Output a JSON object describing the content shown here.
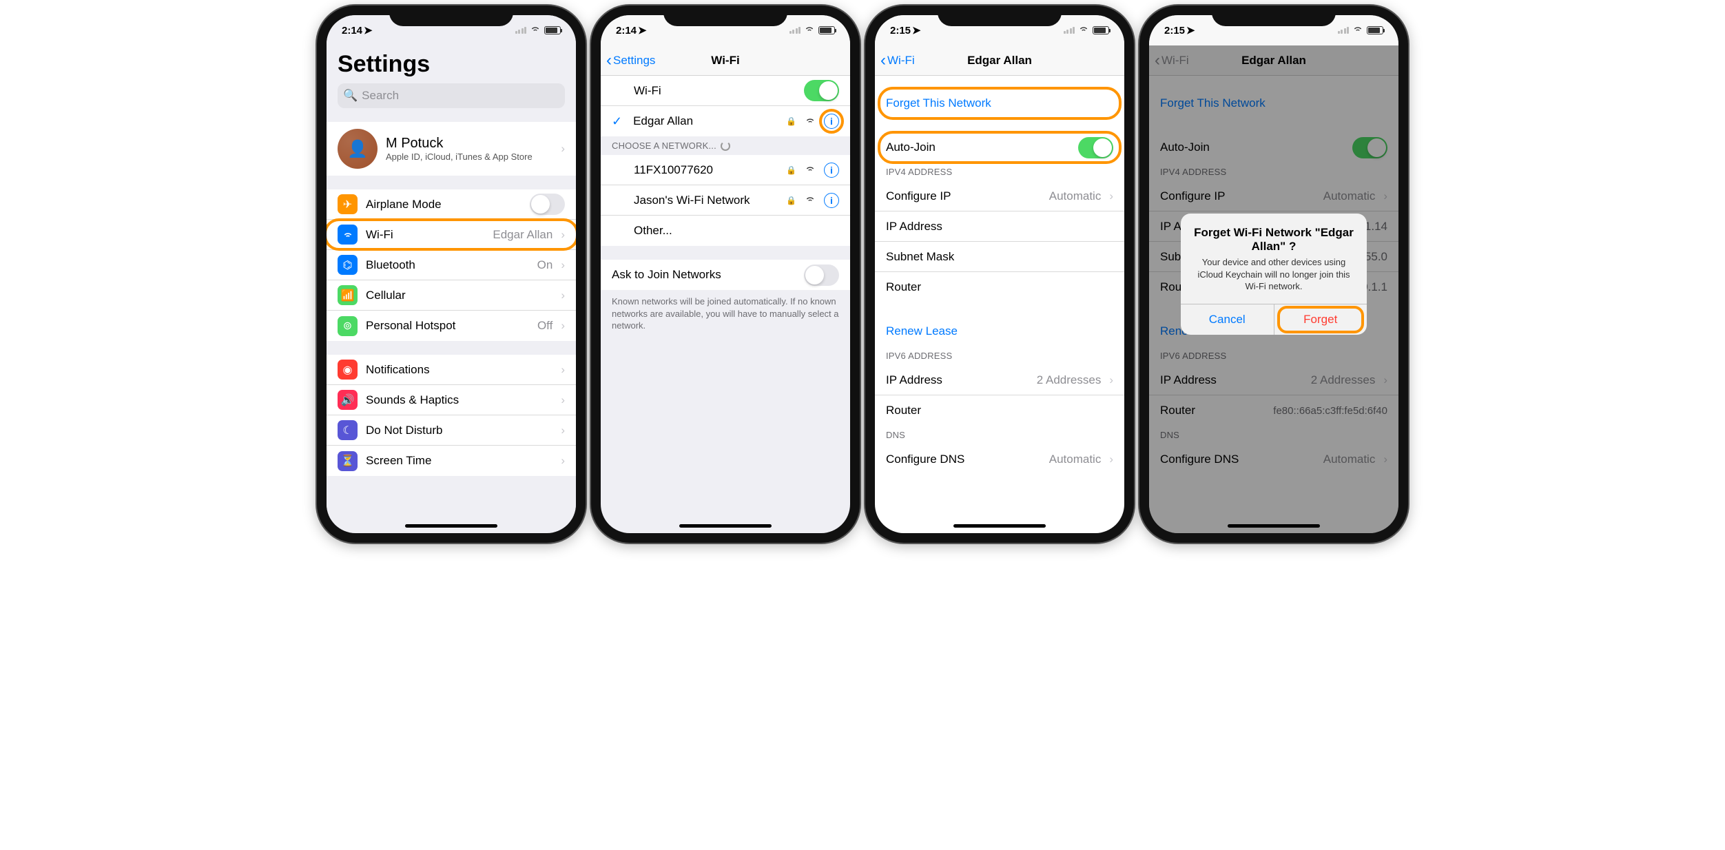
{
  "s1": {
    "time": "2:14",
    "title": "Settings",
    "search_placeholder": "Search",
    "profile": {
      "name": "M Potuck",
      "sub": "Apple ID, iCloud, iTunes & App Store"
    },
    "rows": {
      "airplane": "Airplane Mode",
      "wifi": "Wi-Fi",
      "wifi_val": "Edgar Allan",
      "bluetooth": "Bluetooth",
      "bluetooth_val": "On",
      "cellular": "Cellular",
      "hotspot": "Personal Hotspot",
      "hotspot_val": "Off",
      "notifications": "Notifications",
      "sounds": "Sounds & Haptics",
      "dnd": "Do Not Disturb",
      "screentime": "Screen Time"
    }
  },
  "s2": {
    "time": "2:14",
    "back": "Settings",
    "title": "Wi-Fi",
    "wifi_label": "Wi-Fi",
    "connected": "Edgar Allan",
    "choose_header": "CHOOSE A NETWORK...",
    "networks": {
      "n1": "11FX10077620",
      "n2": "Jason's Wi-Fi Network",
      "other": "Other..."
    },
    "ask_label": "Ask to Join Networks",
    "ask_footer": "Known networks will be joined automatically. If no known networks are available, you will have to manually select a network."
  },
  "s3": {
    "time": "2:15",
    "back": "Wi-Fi",
    "title": "Edgar Allan",
    "forget": "Forget This Network",
    "autojoin": "Auto-Join",
    "ipv4_header": "IPV4 ADDRESS",
    "configure_ip": "Configure IP",
    "configure_ip_val": "Automatic",
    "ip_addr": "IP Address",
    "subnet": "Subnet Mask",
    "router": "Router",
    "renew": "Renew Lease",
    "ipv6_header": "IPV6 ADDRESS",
    "ipv6_ip": "IP Address",
    "ipv6_ip_val": "2 Addresses",
    "ipv6_router": "Router",
    "dns_header": "DNS",
    "configure_dns": "Configure DNS",
    "configure_dns_val": "Automatic"
  },
  "s4": {
    "time": "2:15",
    "back": "Wi-Fi",
    "title": "Edgar Allan",
    "forget": "Forget This Network",
    "autojoin": "Auto-Join",
    "ipv4_header": "IPV4 ADDRESS",
    "configure_ip": "Configure IP",
    "configure_ip_val": "Automatic",
    "ip_addr": "IP Address",
    "ip_addr_val": "10.0.1.14",
    "subnet": "Subnet Mask",
    "subnet_val": "255.255.255.0",
    "router": "Router",
    "router_val": "10.0.1.1",
    "renew": "Renew Lease",
    "ipv6_header": "IPV6 ADDRESS",
    "ipv6_ip": "IP Address",
    "ipv6_ip_val": "2 Addresses",
    "ipv6_router": "Router",
    "ipv6_router_val": "fe80::66a5:c3ff:fe5d:6f40",
    "dns_header": "DNS",
    "configure_dns": "Configure DNS",
    "configure_dns_val": "Automatic",
    "alert": {
      "title": "Forget Wi-Fi Network \"Edgar Allan\" ?",
      "msg": "Your device and other devices using iCloud Keychain will no longer join this Wi-Fi network.",
      "cancel": "Cancel",
      "forget": "Forget"
    }
  }
}
